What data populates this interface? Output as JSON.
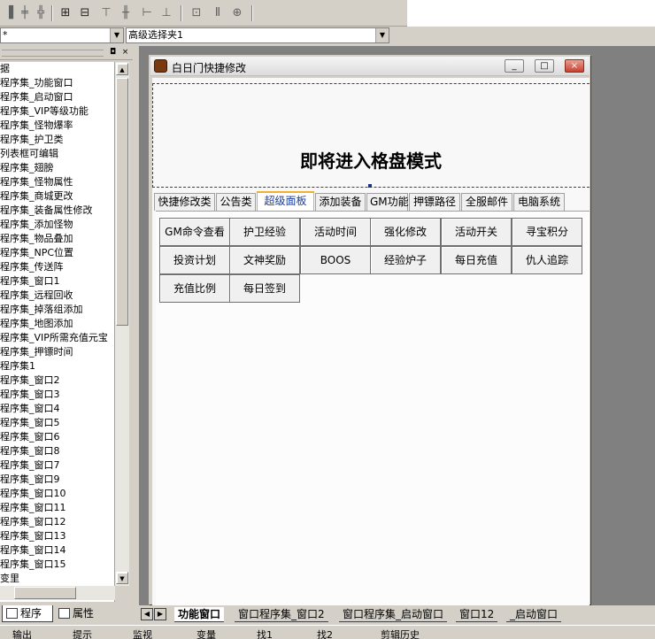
{
  "toolbar": {
    "icons": [
      "align-left-icon",
      "align-center-icon",
      "align-right-icon",
      "center-h-icon",
      "center-v-icon",
      "align-top-icon",
      "align-middle-icon",
      "align-bottom-icon",
      "same-width-icon",
      "same-height-icon",
      "same-size-icon"
    ]
  },
  "combos": {
    "object_value": "*",
    "event_value": "高级选择夹1"
  },
  "tree": {
    "items": [
      "据",
      "程序集_功能窗口",
      "程序集_启动窗口",
      "程序集_VIP等级功能",
      "程序集_怪物爆率",
      "程序集_护卫类",
      "列表框可编辑",
      "程序集_翅膀",
      "程序集_怪物属性",
      "程序集_商城更改",
      "程序集_装备属性修改",
      "程序集_添加怪物",
      "程序集_物品叠加",
      "程序集_NPC位置",
      "程序集_传送阵",
      "程序集_窗口1",
      "程序集_远程回收",
      "程序集_掉落组添加",
      "程序集_地图添加",
      "程序集_VIP所需充值元宝",
      "程序集_押镖时间",
      "程序集1",
      "程序集_窗口2",
      "程序集_窗口3",
      "程序集_窗口4",
      "程序集_窗口5",
      "程序集_窗口6",
      "程序集_窗口8",
      "程序集_窗口7",
      "程序集_窗口9",
      "程序集_窗口10",
      "程序集_窗口11",
      "程序集_窗口12",
      "程序集_窗口13",
      "程序集_窗口14",
      "程序集_窗口15",
      "变里"
    ]
  },
  "left_tabs": {
    "program": "程序",
    "properties": "属性"
  },
  "window": {
    "title": "白日门快捷修改",
    "heading": "即将进入格盘模式",
    "minimize": "_",
    "maximize": "□",
    "close": "×"
  },
  "tabs": [
    "快捷修改类",
    "公告类",
    "超级面板",
    "添加装备",
    "GM功能",
    "押镖路径",
    "全服邮件",
    "电脑系统"
  ],
  "active_tab": 2,
  "buttons": [
    [
      "GM命令查看",
      "护卫经验",
      "活动时间",
      "强化修改",
      "活动开关",
      "寻宝积分"
    ],
    [
      "投资计划",
      "文神奖励",
      "BOOS",
      "经验炉子",
      "每日充值",
      "仇人追踪"
    ],
    [
      "充值比例",
      "每日签到"
    ]
  ],
  "bottom_tabs": {
    "items": [
      "功能窗口",
      "窗口程序集_窗口2",
      "窗口程序集_启动窗口",
      "窗口12",
      "_启动窗口"
    ],
    "active": 0
  },
  "statusbar": {
    "items": [
      "输出",
      "提示",
      "监视",
      "变量",
      "找1",
      "找2",
      "剪辑历史"
    ]
  }
}
